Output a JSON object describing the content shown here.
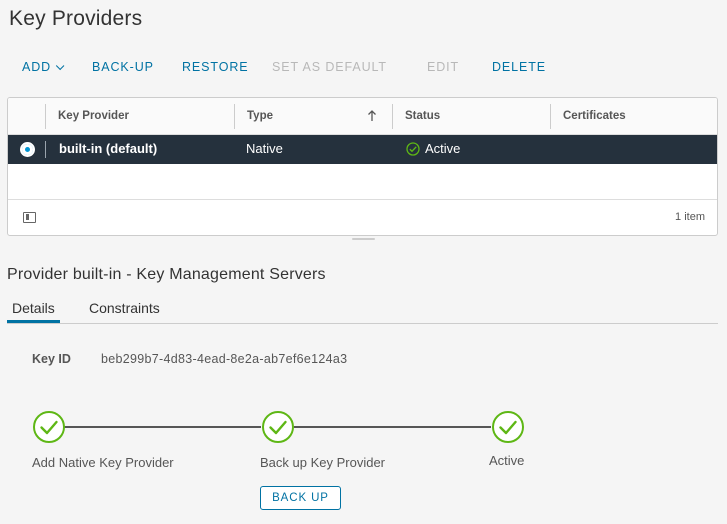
{
  "page": {
    "title": "Key Providers"
  },
  "toolbar": {
    "add": "ADD",
    "backup": "BACK-UP",
    "restore": "RESTORE",
    "set_default": "SET AS DEFAULT",
    "edit": "EDIT",
    "delete": "DELETE"
  },
  "grid": {
    "columns": [
      "Key Provider",
      "Type",
      "Status",
      "Certificates"
    ],
    "sorted_column": "Type",
    "rows": [
      {
        "selected": true,
        "key_provider": "built-in (default)",
        "type": "Native",
        "status": "Active",
        "certificates": ""
      }
    ],
    "footer_count": "1 item"
  },
  "detail": {
    "title": "Provider built-in - Key Management Servers",
    "tabs": [
      "Details",
      "Constraints"
    ],
    "active_tab": "Details",
    "key_id_label": "Key ID",
    "key_id_value": "beb299b7-4d83-4ead-8e2a-ab7ef6e124a3",
    "steps": [
      "Add Native Key Provider",
      "Back up Key Provider",
      "Active"
    ],
    "backup_button": "BACK UP"
  },
  "colors": {
    "accent": "#0072a3",
    "selected_row": "#25313d",
    "success": "#5eb715",
    "disabled": "#b8b8b8"
  }
}
